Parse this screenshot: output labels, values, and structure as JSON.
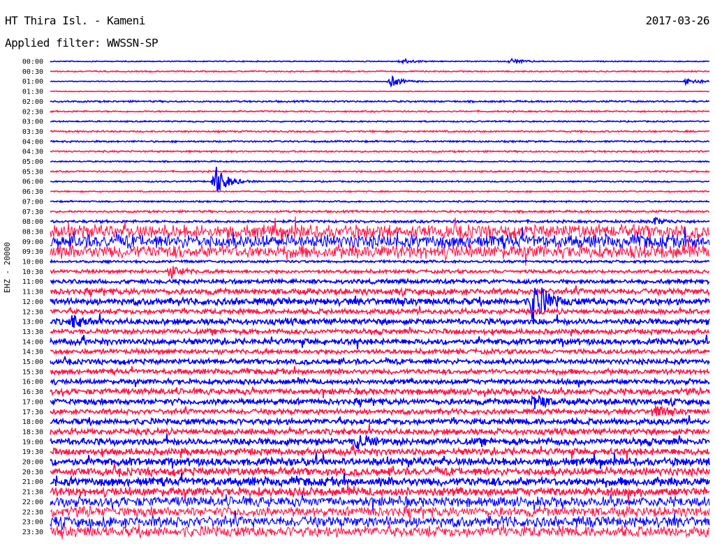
{
  "header": {
    "station": "HT Thira Isl. - Kameni",
    "date": "2017-03-26",
    "filter": "Applied filter: WWSSN-SP"
  },
  "channel_label": "EHZ - 20000",
  "colors": {
    "odd_trace": "#0000ff",
    "even_trace": "#ff1a4b"
  },
  "chart_data": {
    "type": "line",
    "title": "",
    "ylabel": "EHZ - 20000",
    "rows": [
      "00:00",
      "00:30",
      "01:00",
      "01:30",
      "02:00",
      "02:30",
      "03:00",
      "03:30",
      "04:00",
      "04:30",
      "05:00",
      "05:30",
      "06:00",
      "06:30",
      "07:00",
      "07:30",
      "08:00",
      "08:30",
      "09:00",
      "09:30",
      "10:00",
      "10:30",
      "11:00",
      "11:30",
      "12:00",
      "12:30",
      "13:00",
      "13:30",
      "14:00",
      "14:30",
      "15:00",
      "15:30",
      "16:00",
      "16:30",
      "17:00",
      "17:30",
      "18:00",
      "18:30",
      "19:00",
      "19:30",
      "20:00",
      "20:30",
      "21:00",
      "21:30",
      "22:00",
      "22:30",
      "23:00",
      "23:30"
    ],
    "row_noise": [
      0.6,
      0.8,
      0.5,
      0.5,
      1.0,
      0.9,
      0.8,
      1.0,
      1.0,
      1.0,
      0.8,
      0.9,
      0.8,
      0.8,
      0.9,
      1.2,
      1.5,
      8.0,
      8.0,
      8.0,
      1.5,
      2.0,
      2.5,
      3.5,
      4.0,
      3.0,
      3.5,
      3.0,
      3.5,
      2.8,
      3.0,
      3.0,
      3.0,
      3.5,
      3.5,
      3.0,
      3.5,
      3.5,
      4.0,
      4.0,
      4.5,
      4.5,
      5.0,
      5.0,
      6.0,
      6.0,
      6.5,
      6.5
    ],
    "events": [
      {
        "row": "00:00",
        "minute": 16,
        "amplitude": 4
      },
      {
        "row": "00:00",
        "minute": 21,
        "amplitude": 4
      },
      {
        "row": "01:00",
        "minute": 15.5,
        "amplitude": 8
      },
      {
        "row": "01:00",
        "minute": 29,
        "amplitude": 6
      },
      {
        "row": "06:00",
        "minute": 7.5,
        "amplitude": 25
      },
      {
        "row": "08:00",
        "minute": 27.5,
        "amplitude": 5
      },
      {
        "row": "10:30",
        "minute": 5.5,
        "amplitude": 9
      },
      {
        "row": "12:00",
        "minute": 22,
        "amplitude": 35
      },
      {
        "row": "13:00",
        "minute": 1,
        "amplitude": 8
      },
      {
        "row": "17:00",
        "minute": 22,
        "amplitude": 10
      },
      {
        "row": "17:30",
        "minute": 27.5,
        "amplitude": 8
      },
      {
        "row": "19:00",
        "minute": 14,
        "amplitude": 10
      }
    ]
  }
}
